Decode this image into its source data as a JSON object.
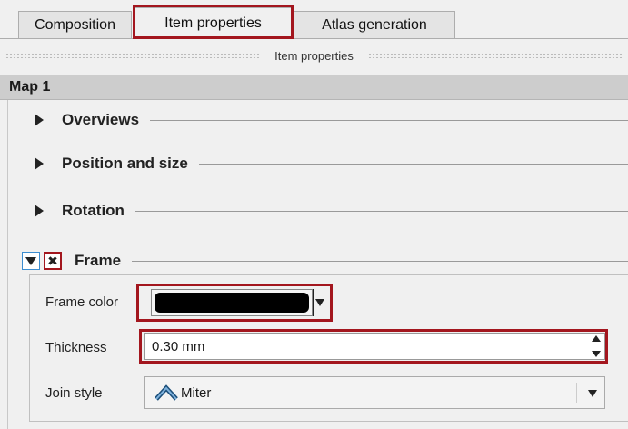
{
  "tabs": [
    {
      "label": "Composition",
      "active": false
    },
    {
      "label": "Item properties",
      "active": true
    },
    {
      "label": "Atlas generation",
      "active": false
    }
  ],
  "dock": {
    "title": "Item properties"
  },
  "item": {
    "name": "Map 1"
  },
  "groups": [
    {
      "label": "Overviews",
      "expanded": false
    },
    {
      "label": "Position and size",
      "expanded": false
    },
    {
      "label": "Rotation",
      "expanded": false
    }
  ],
  "frame": {
    "label": "Frame",
    "expanded": true,
    "checked": true,
    "color_label": "Frame color",
    "color_value": "#000000",
    "thickness_label": "Thickness",
    "thickness_value": "0.30 mm",
    "join_label": "Join style",
    "join_value": "Miter"
  },
  "colors": {
    "highlight": "#a3161e",
    "accent": "#3c8dd0"
  }
}
